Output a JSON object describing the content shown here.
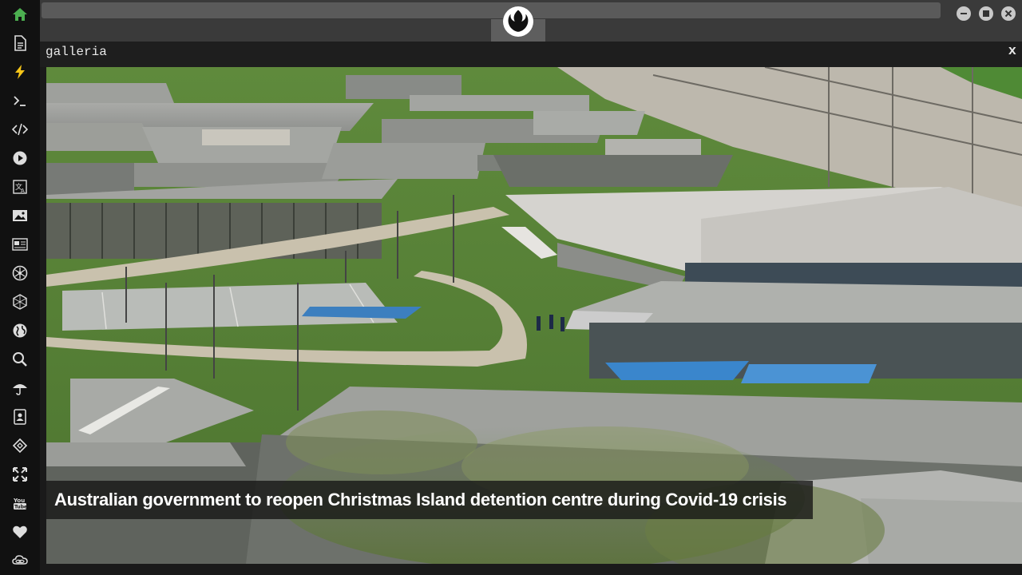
{
  "window": {
    "title": "galleria",
    "close_label": "x"
  },
  "sidebar": {
    "items": [
      {
        "name": "home-icon",
        "accent": "#4caf50"
      },
      {
        "name": "document-icon"
      },
      {
        "name": "lightning-icon",
        "accent": "#f5c518"
      },
      {
        "name": "terminal-icon"
      },
      {
        "name": "code-icon"
      },
      {
        "name": "play-icon"
      },
      {
        "name": "translate-icon"
      },
      {
        "name": "image-icon"
      },
      {
        "name": "news-icon"
      },
      {
        "name": "rebel-alliance-icon"
      },
      {
        "name": "hexagon-icon"
      },
      {
        "name": "globe-icon"
      },
      {
        "name": "search-icon"
      },
      {
        "name": "umbrella-icon"
      },
      {
        "name": "contact-card-icon"
      },
      {
        "name": "api-icon"
      },
      {
        "name": "expand-icon"
      },
      {
        "name": "youtube-icon"
      },
      {
        "name": "heart-icon"
      },
      {
        "name": "cloud-link-icon"
      }
    ]
  },
  "gallery": {
    "caption": "Australian government to reopen Christmas Island detention centre during Covid-19 crisis"
  },
  "colors": {
    "sidebar_bg": "#111111",
    "accent_green": "#4caf50",
    "accent_yellow": "#f5c518"
  }
}
